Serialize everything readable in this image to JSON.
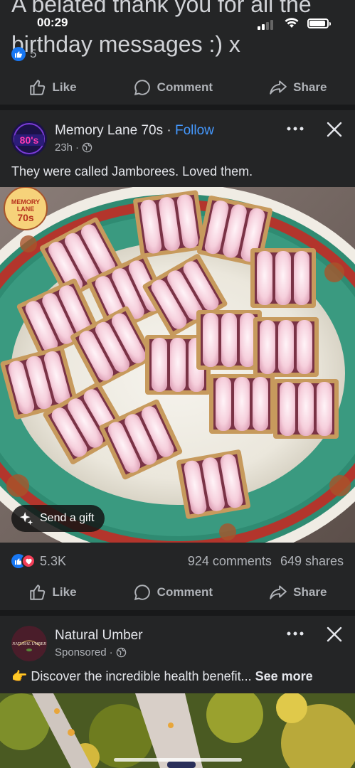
{
  "status_bar": {
    "time": "00:29"
  },
  "previous_post": {
    "text_line1": "A belated thank you for all the",
    "text_line2": "birthday messages :) x",
    "reaction_count": "5",
    "actions": {
      "like": "Like",
      "comment": "Comment",
      "share": "Share"
    }
  },
  "post": {
    "page_name": "Memory Lane 70s",
    "separator": " · ",
    "follow_label": "Follow",
    "time": "23h",
    "separator_dot": "·",
    "text": "They were called Jamborees. Loved them.",
    "image_logo_text": {
      "line1": "MEMORY",
      "line2": "LANE",
      "line3": "70s"
    },
    "avatar_text": "80's",
    "gift_label": "Send a gift",
    "reaction_count": "5.3K",
    "comments": "924 comments",
    "shares": "649 shares",
    "actions": {
      "like": "Like",
      "comment": "Comment",
      "share": "Share"
    }
  },
  "sponsored_post": {
    "page_name": "Natural Umber",
    "avatar_text": "NATURAL UMBER",
    "sponsored_label": "Sponsored",
    "separator_dot": "·",
    "emoji": "👉",
    "text": " Discover the incredible health benefit... ",
    "see_more": "See more"
  },
  "colors": {
    "background": "#242526",
    "divider": "#18191a",
    "follow_blue": "#4599ff",
    "like_blue": "#1877f2",
    "love_red": "#f33e58"
  }
}
